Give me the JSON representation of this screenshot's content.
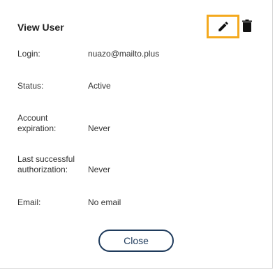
{
  "dialog": {
    "title": "View User",
    "close_label": "Close"
  },
  "toolbar": {
    "edit_icon": "pencil-icon",
    "delete_icon": "trash-icon",
    "highlight_color": "#f4a91e"
  },
  "fields": {
    "login": {
      "label": "Login:",
      "value": "nuazo@mailto.plus"
    },
    "status": {
      "label": "Status:",
      "value": "Active"
    },
    "account_expiration": {
      "label_line1": "Account",
      "label_line2": "expiration:",
      "value": "Never"
    },
    "last_auth": {
      "label_line1": "Last successful",
      "label_line2": "authorization:",
      "value": "Never"
    },
    "email": {
      "label": "Email:",
      "value": "No email"
    }
  }
}
